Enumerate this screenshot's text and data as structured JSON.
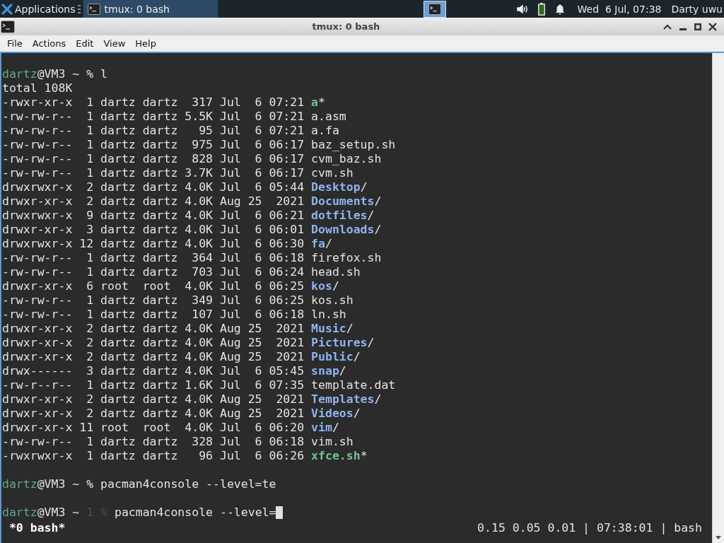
{
  "panel": {
    "apps_label": "Applications",
    "tasks": [
      {
        "label": "tmux: 0 bash",
        "selected": true
      }
    ],
    "workspaces": [
      {
        "selected": true
      }
    ],
    "clock": "Wed  6 Jul, 07:38",
    "user": "Darty uwu"
  },
  "window": {
    "title": "tmux: 0 bash"
  },
  "menu": [
    "File",
    "Actions",
    "Edit",
    "View",
    "Help"
  ],
  "terminal": {
    "lines": [
      {
        "kind": "blank"
      },
      {
        "kind": "prompt",
        "user": "dartz",
        "host": "@VM3 ~",
        "symbol": "%",
        "command": "l"
      },
      {
        "kind": "text",
        "text": "total 108K"
      },
      {
        "kind": "exec",
        "info": "-rwxr-xr-x  1 dartz dartz  317 Jul  6 07:21",
        "name": "a",
        "suffix": "*"
      },
      {
        "kind": "file",
        "info": "-rw-rw-r--  1 dartz dartz 5.5K Jul  6 07:21",
        "name": "a.asm"
      },
      {
        "kind": "file",
        "info": "-rw-rw-r--  1 dartz dartz   95 Jul  6 07:21",
        "name": "a.fa"
      },
      {
        "kind": "file",
        "info": "-rw-rw-r--  1 dartz dartz  975 Jul  6 06:17",
        "name": "baz_setup.sh"
      },
      {
        "kind": "file",
        "info": "-rw-rw-r--  1 dartz dartz  828 Jul  6 06:17",
        "name": "cvm_baz.sh"
      },
      {
        "kind": "file",
        "info": "-rw-rw-r--  1 dartz dartz 3.7K Jul  6 06:17",
        "name": "cvm.sh"
      },
      {
        "kind": "dir",
        "info": "drwxrwxr-x  2 dartz dartz 4.0K Jul  6 05:44",
        "name": "Desktop",
        "suffix": "/"
      },
      {
        "kind": "dir",
        "info": "drwxr-xr-x  2 dartz dartz 4.0K Aug 25  2021",
        "name": "Documents",
        "suffix": "/"
      },
      {
        "kind": "dir",
        "info": "drwxrwxr-x  9 dartz dartz 4.0K Jul  6 06:21",
        "name": "dotfiles",
        "suffix": "/"
      },
      {
        "kind": "dir",
        "info": "drwxr-xr-x  3 dartz dartz 4.0K Jul  6 06:01",
        "name": "Downloads",
        "suffix": "/"
      },
      {
        "kind": "dir",
        "info": "drwxrwxr-x 12 dartz dartz 4.0K Jul  6 06:30",
        "name": "fa",
        "suffix": "/"
      },
      {
        "kind": "file",
        "info": "-rw-rw-r--  1 dartz dartz  364 Jul  6 06:18",
        "name": "firefox.sh"
      },
      {
        "kind": "file",
        "info": "-rw-rw-r--  1 dartz dartz  703 Jul  6 06:24",
        "name": "head.sh"
      },
      {
        "kind": "dir",
        "info": "drwxr-xr-x  6 root  root  4.0K Jul  6 06:25",
        "name": "kos",
        "suffix": "/"
      },
      {
        "kind": "file",
        "info": "-rw-rw-r--  1 dartz dartz  349 Jul  6 06:25",
        "name": "kos.sh"
      },
      {
        "kind": "file",
        "info": "-rw-rw-r--  1 dartz dartz  107 Jul  6 06:18",
        "name": "ln.sh"
      },
      {
        "kind": "dir",
        "info": "drwxr-xr-x  2 dartz dartz 4.0K Aug 25  2021",
        "name": "Music",
        "suffix": "/"
      },
      {
        "kind": "dir",
        "info": "drwxr-xr-x  2 dartz dartz 4.0K Aug 25  2021",
        "name": "Pictures",
        "suffix": "/"
      },
      {
        "kind": "dir",
        "info": "drwxr-xr-x  2 dartz dartz 4.0K Aug 25  2021",
        "name": "Public",
        "suffix": "/"
      },
      {
        "kind": "dir",
        "info": "drwx------  3 dartz dartz 4.0K Jul  6 05:45",
        "name": "snap",
        "suffix": "/"
      },
      {
        "kind": "file",
        "info": "-rw-r--r--  1 dartz dartz 1.6K Jul  6 07:35",
        "name": "template.dat"
      },
      {
        "kind": "dir",
        "info": "drwxr-xr-x  2 dartz dartz 4.0K Aug 25  2021",
        "name": "Templates",
        "suffix": "/"
      },
      {
        "kind": "dir",
        "info": "drwxr-xr-x  2 dartz dartz 4.0K Aug 25  2021",
        "name": "Videos",
        "suffix": "/"
      },
      {
        "kind": "dir",
        "info": "drwxr-xr-x 11 root  root  4.0K Jul  6 06:20",
        "name": "vim",
        "suffix": "/"
      },
      {
        "kind": "file",
        "info": "-rw-rw-r--  1 dartz dartz  328 Jul  6 06:18",
        "name": "vim.sh"
      },
      {
        "kind": "exec",
        "info": "-rwxrwxr-x  1 dartz dartz   96 Jul  6 06:26",
        "name": "xfce.sh",
        "suffix": "*"
      },
      {
        "kind": "blank"
      },
      {
        "kind": "prompt",
        "user": "dartz",
        "host": "@VM3 ~",
        "symbol": "%",
        "command": "pacman4console --level=te"
      },
      {
        "kind": "blank"
      },
      {
        "kind": "prompt",
        "user": "dartz",
        "host": "@VM3 ~",
        "exit_code": "1",
        "symbol": "%",
        "command": "pacman4console --level=",
        "cursor": true
      }
    ]
  },
  "tmux_status": {
    "windows": [
      "*0 bash*"
    ],
    "right": "0.15 0.05 0.01 | 07:38:01 | bash"
  }
}
